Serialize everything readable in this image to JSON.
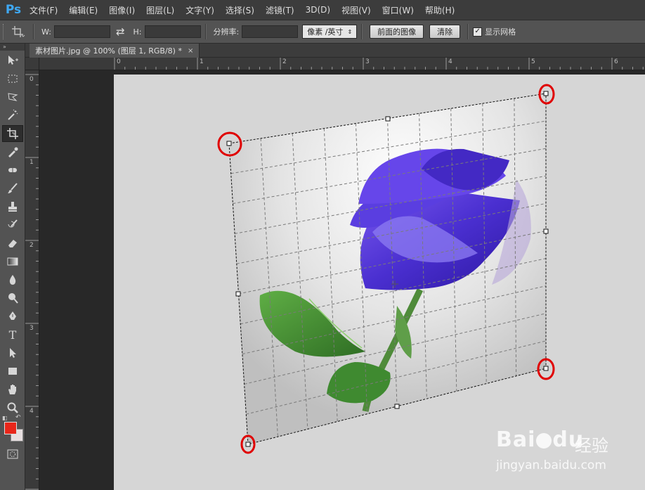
{
  "app": {
    "logo": "Ps"
  },
  "menu": [
    "文件(F)",
    "编辑(E)",
    "图像(I)",
    "图层(L)",
    "文字(Y)",
    "选择(S)",
    "滤镜(T)",
    "3D(D)",
    "视图(V)",
    "窗口(W)",
    "帮助(H)"
  ],
  "options": {
    "width_label": "W:",
    "height_label": "H:",
    "swap_icon": "⇄",
    "resolution_label": "分辨率:",
    "unit_select": "像素 /英寸",
    "front_image_button": "前面的图像",
    "clear_button": "清除",
    "show_grid_label": "显示网格",
    "show_grid_checked": true
  },
  "document_tab": {
    "title": "素材图片.jpg @ 100% (图层 1, RGB/8) *",
    "close": "×"
  },
  "ruler": {
    "horizontal": [
      "0",
      "1",
      "2",
      "3",
      "4",
      "5",
      "6"
    ],
    "vertical": [
      "0",
      "1",
      "2",
      "3",
      "4"
    ]
  },
  "colors": {
    "foreground": "#e8261a",
    "background": "#e7dfe0",
    "highlight": "#e00000"
  },
  "watermark": {
    "brand": "Bai",
    "brand_suffix": "du",
    "service": "经验",
    "url": "jingyan.baidu.com"
  },
  "tools": [
    "move-tool",
    "marquee-tool",
    "lasso-tool",
    "magic-wand-tool",
    "crop-tool",
    "eyedropper-tool",
    "healing-brush-tool",
    "brush-tool",
    "clone-stamp-tool",
    "history-brush-tool",
    "eraser-tool",
    "gradient-tool",
    "blur-tool",
    "dodge-tool",
    "pen-tool",
    "type-tool",
    "path-selection-tool",
    "rectangle-tool",
    "hand-tool",
    "zoom-tool"
  ]
}
